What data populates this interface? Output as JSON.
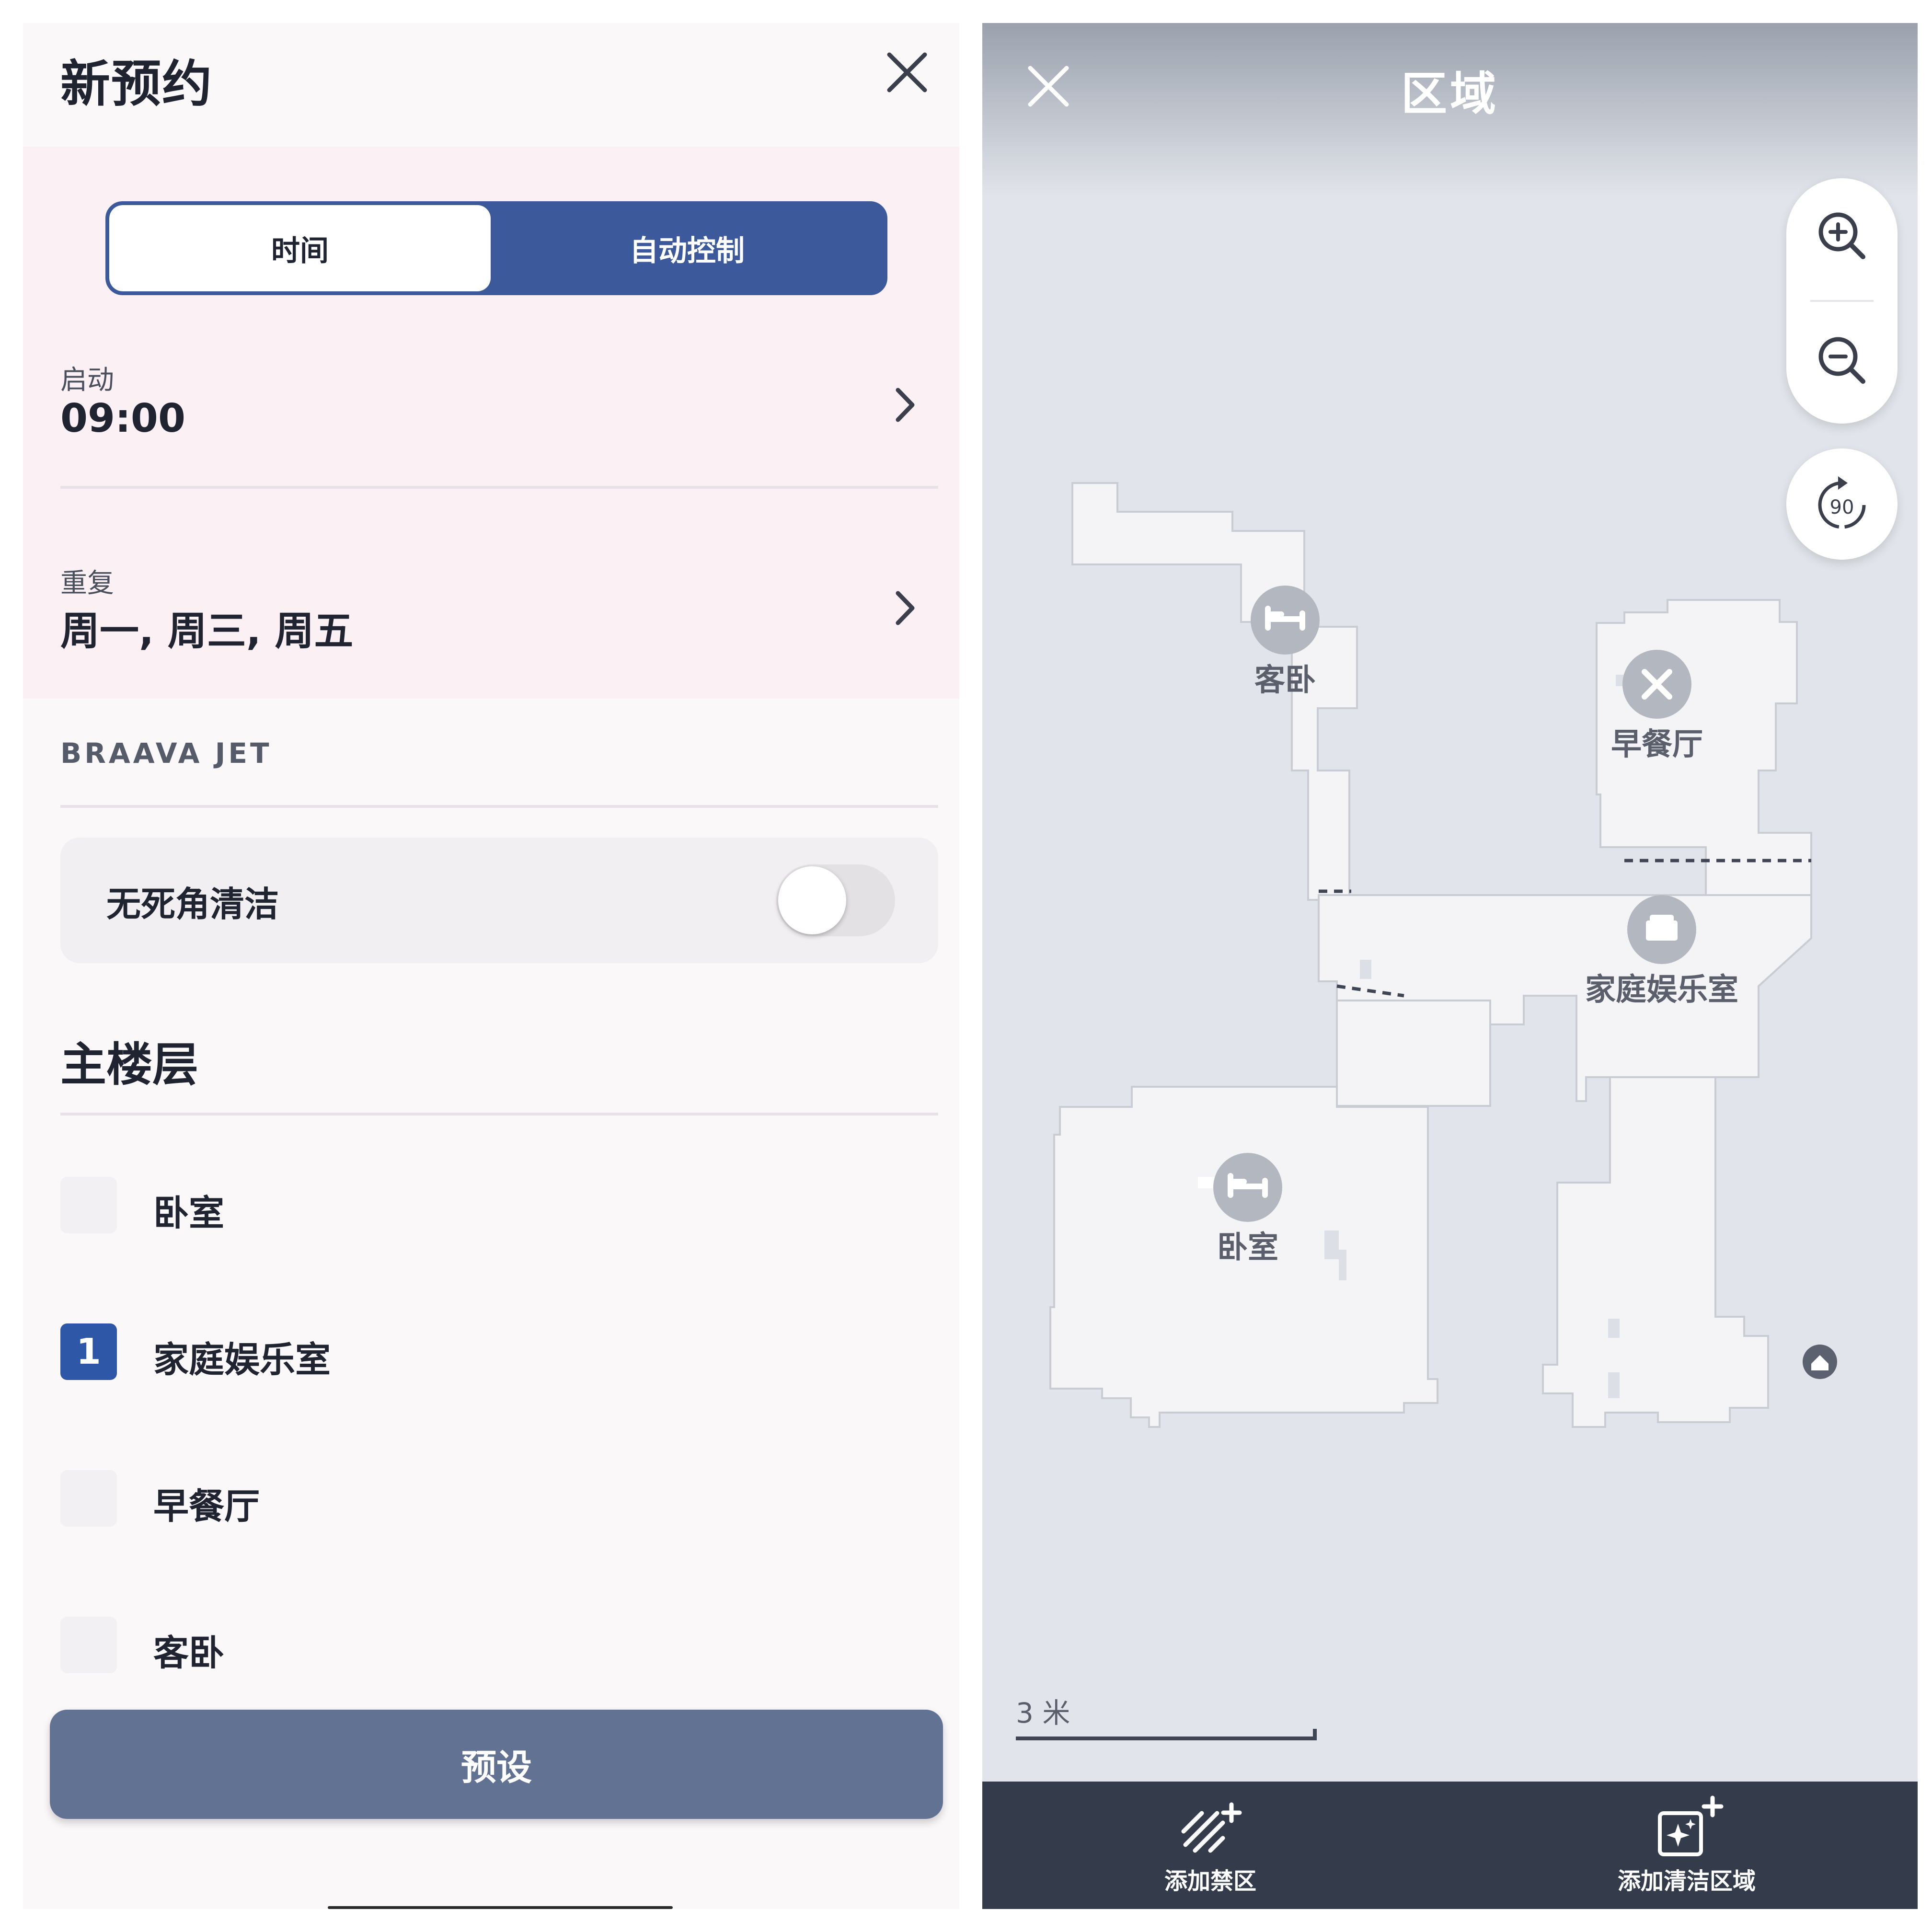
{
  "left_panel": {
    "title": "新预约",
    "segmented": {
      "left": "时间",
      "right": "自动控制"
    },
    "start": {
      "label": "启动",
      "value": "09:00"
    },
    "repeat": {
      "label": "重复",
      "value": "周一, 周三, 周五"
    },
    "device_section": "BRAAVA JET",
    "edge_clean": {
      "label": "无死角清洁",
      "enabled": false
    },
    "floor_title": "主楼层",
    "rooms": [
      {
        "label": "卧室",
        "order": ""
      },
      {
        "label": "家庭娱乐室",
        "order": "1"
      },
      {
        "label": "早餐厅",
        "order": ""
      },
      {
        "label": "客卧",
        "order": ""
      }
    ],
    "preset_button": "预设"
  },
  "right_panel": {
    "title": "区域",
    "rotate_label": "90",
    "map_rooms": [
      {
        "name": "客卧",
        "icon": "bed-icon"
      },
      {
        "name": "早餐厅",
        "icon": "fork-knife-icon"
      },
      {
        "name": "家庭娱乐室",
        "icon": "armchair-icon"
      },
      {
        "name": "卧室",
        "icon": "bed-icon"
      }
    ],
    "scale": "3 米",
    "bottom_actions": [
      {
        "label": "添加禁区",
        "icon": "keep-out-zone-icon"
      },
      {
        "label": "添加清洁区域",
        "icon": "clean-zone-icon"
      }
    ]
  },
  "colors": {
    "accent": "#3c5a9b",
    "checked": "#2f57a8",
    "preset_button": "#627293",
    "bottom_bar": "#343c4b",
    "map_bg": "#e1e4ea",
    "map_floor": "#f4f4f6"
  }
}
